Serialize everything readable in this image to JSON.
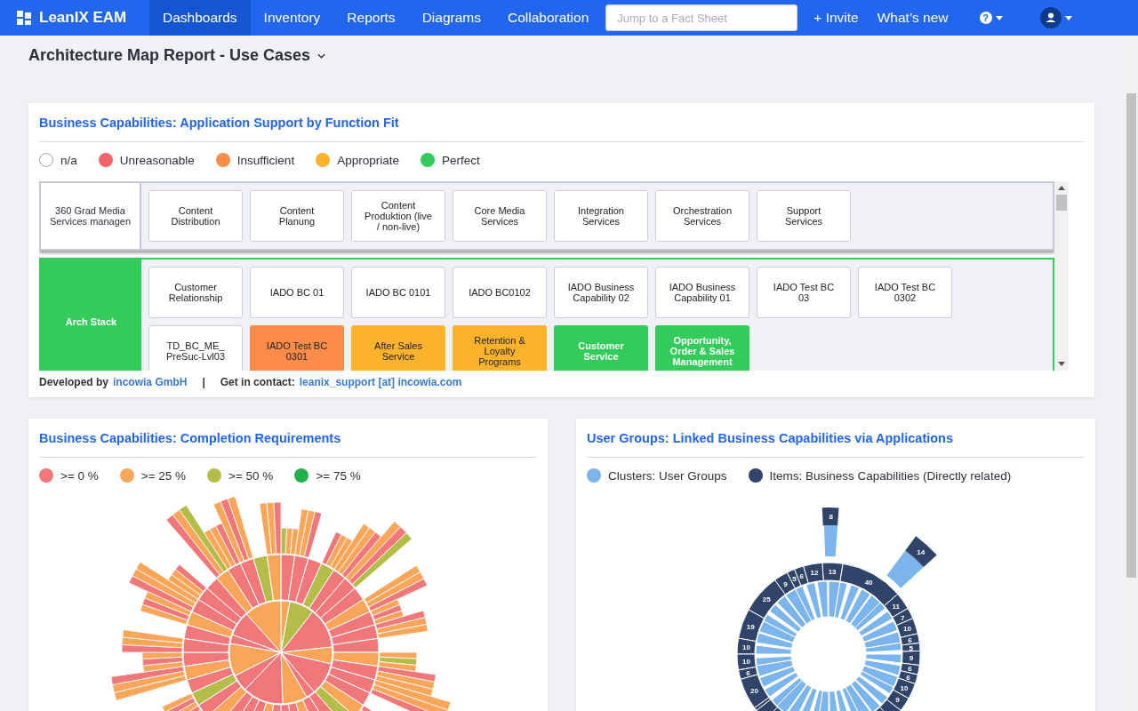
{
  "nav": {
    "logo": "LeanIX EAM",
    "items": [
      {
        "label": "Dashboards",
        "selected": true
      },
      {
        "label": "Inventory",
        "selected": false
      },
      {
        "label": "Reports",
        "selected": false
      },
      {
        "label": "Diagrams",
        "selected": false
      },
      {
        "label": "Collaboration",
        "selected": false
      }
    ],
    "search": {
      "placeholder": "Jump to a Fact Sheet"
    },
    "invite": "+ Invite",
    "whats_new": "What’s new",
    "help": "?"
  },
  "page_title": "Architecture Map Report - Use Cases",
  "map_card": {
    "title": "Business Capabilities: Application Support by Function Fit",
    "legend": [
      {
        "kind": "na",
        "label": "n/a",
        "color": "#ffffff"
      },
      {
        "kind": "unreasonable",
        "label": "Unreasonable",
        "color": "#f0656b"
      },
      {
        "kind": "insufficient",
        "label": "Insufficient",
        "color": "#fd8c4b"
      },
      {
        "kind": "appropriate",
        "label": "Appropriate",
        "color": "#fcb32b"
      },
      {
        "kind": "perfect",
        "label": "Perfect",
        "color": "#33cc5a"
      }
    ],
    "rows": [
      {
        "name": "360 Grad Media Services managen",
        "kind": "na",
        "capabilities": [
          {
            "name": "Content Distribution",
            "kind": "na"
          },
          {
            "name": "Content Planung",
            "kind": "na"
          },
          {
            "name": "Content Produktion (live / non-live)",
            "kind": "na"
          },
          {
            "name": "Core Media Services",
            "kind": "na"
          },
          {
            "name": "Integration Services",
            "kind": "na"
          },
          {
            "name": "Orchestration Services",
            "kind": "na"
          },
          {
            "name": "Support Services",
            "kind": "na"
          }
        ]
      },
      {
        "name": "Arch Stack",
        "kind": "perfect",
        "capabilities": [
          {
            "name": "Customer Relationship",
            "kind": "na"
          },
          {
            "name": "IADO BC 01",
            "kind": "na"
          },
          {
            "name": "IADO BC 0101",
            "kind": "na"
          },
          {
            "name": "IADO BC0102",
            "kind": "na"
          },
          {
            "name": "IADO Business Capability 02",
            "kind": "na"
          },
          {
            "name": "IADO Business Capability 01",
            "kind": "na"
          },
          {
            "name": "IADO Test BC 03",
            "kind": "na"
          },
          {
            "name": "IADO Test BC 0302",
            "kind": "na"
          },
          {
            "name": "TD_BC_ME_ PreSuc-Lvl03",
            "kind": "na"
          },
          {
            "name": "IADO Test BC 0301",
            "kind": "insufficient"
          },
          {
            "name": "After Sales Service",
            "kind": "appropriate"
          },
          {
            "name": "Retention & Loyalty Programs",
            "kind": "appropriate"
          },
          {
            "name": "Customer Service",
            "kind": "perfect"
          },
          {
            "name": "Opportunity, Order & Sales Management",
            "kind": "perfect"
          }
        ]
      }
    ],
    "footer": {
      "developed_label": "Developed by",
      "developer": "incowia GmbH",
      "separator": "|",
      "contact_label": "Get in contact:",
      "contact": "leanix_support [at] incowia.com"
    }
  },
  "completion_card": {
    "title": "Business Capabilities: Completion Requirements",
    "legend": [
      {
        "label": ">= 0 %",
        "color": "#f0787a"
      },
      {
        "label": ">= 25 %",
        "color": "#f9a65a"
      },
      {
        "label": ">= 50 %",
        "color": "#b5bd4a"
      },
      {
        "label": ">= 75 %",
        "color": "#22b04b"
      }
    ]
  },
  "user_groups_card": {
    "title": "User Groups: Linked Business Capabilities via Applications",
    "legend": [
      {
        "label": "Clusters: User Groups",
        "color": "#7cb5ec"
      },
      {
        "label": "Items: Business Capabilities (Directly related)",
        "color": "#2f4468"
      }
    ],
    "outlier_labels": [
      "8",
      "14"
    ],
    "left_labels": [
      "12",
      "6",
      "5",
      "9",
      "25",
      "19",
      "10",
      "10",
      "6",
      "20"
    ],
    "right_labels": [
      "13",
      "40",
      "11",
      "7",
      "10",
      "6",
      "5",
      "9",
      "6",
      "6",
      "10",
      "9"
    ]
  }
}
